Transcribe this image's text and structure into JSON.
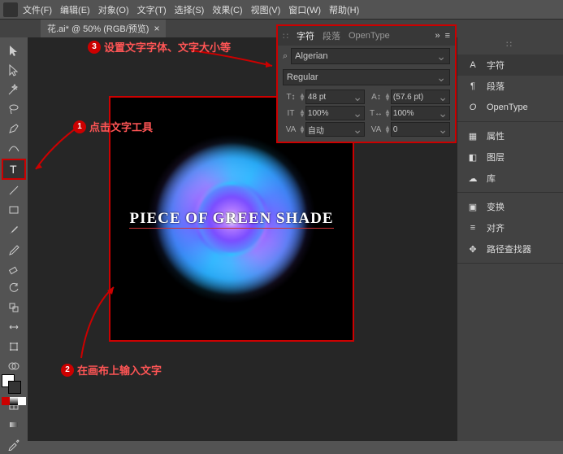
{
  "menu": {
    "items": [
      "文件(F)",
      "编辑(E)",
      "对象(O)",
      "文字(T)",
      "选择(S)",
      "效果(C)",
      "视图(V)",
      "窗口(W)",
      "帮助(H)"
    ]
  },
  "doc_tab": {
    "title": "花.ai* @ 50% (RGB/预览)"
  },
  "annotations": {
    "a1": {
      "num": "1",
      "text": "点击文字工具"
    },
    "a2": {
      "num": "2",
      "text": "在画布上输入文字"
    },
    "a3": {
      "num": "3",
      "text": "设置文字字体、文字大小等"
    }
  },
  "canvas_text": "PIECE OF GREEN SHADE",
  "char_panel": {
    "tabs": [
      "字符",
      "段落",
      "OpenType"
    ],
    "more": "»",
    "burger": "≡",
    "font": "Algerian",
    "style": "Regular",
    "size": "48 pt",
    "leading": "(57.6 pt)",
    "hscale": "100%",
    "vscale": "100%",
    "kerning": "自动",
    "tracking": "0",
    "search_icon": "⌕"
  },
  "right_panels": {
    "items1": [
      {
        "icon": "A",
        "label": "字符"
      },
      {
        "icon": "¶",
        "label": "段落"
      },
      {
        "icon": "O",
        "label": "OpenType"
      }
    ],
    "items2": [
      {
        "icon": "▦",
        "label": "属性"
      },
      {
        "icon": "◧",
        "label": "图层"
      },
      {
        "icon": "☁",
        "label": "库"
      }
    ],
    "items3": [
      {
        "icon": "▣",
        "label": "变换"
      },
      {
        "icon": "≡",
        "label": "对齐"
      },
      {
        "icon": "✥",
        "label": "路径查找器"
      }
    ]
  }
}
